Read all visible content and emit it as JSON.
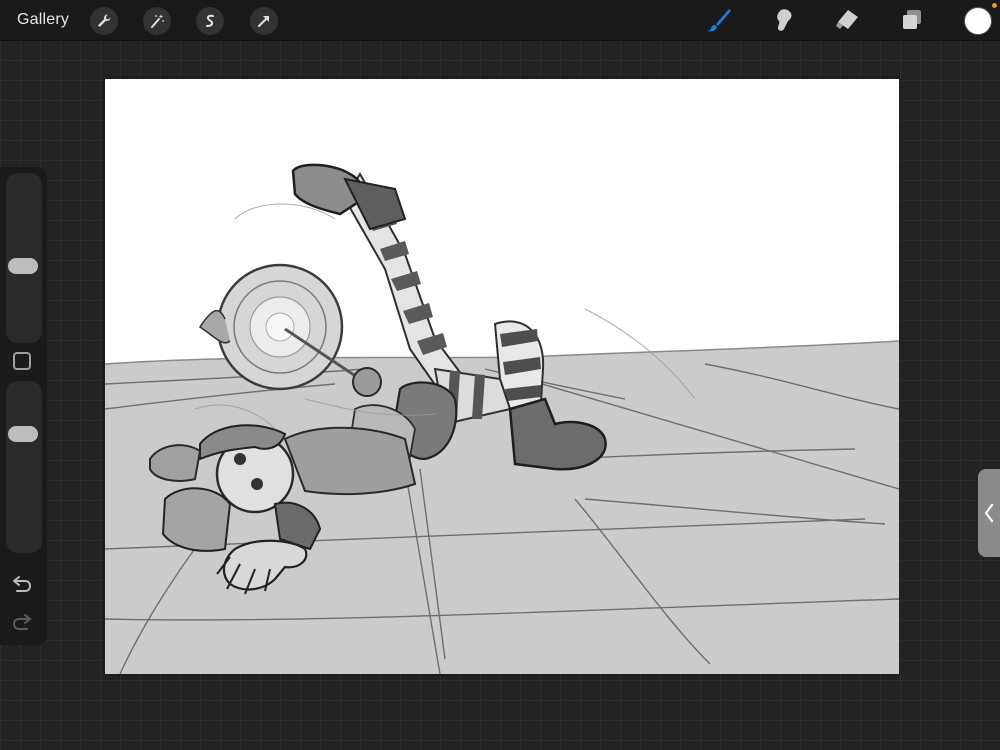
{
  "topbar": {
    "gallery_label": "Gallery",
    "left_tools": [
      {
        "icon": "wrench-icon",
        "name": "actions-button"
      },
      {
        "icon": "magic-wand-icon",
        "name": "adjustments-button"
      },
      {
        "icon": "selection-s-icon",
        "name": "selection-button"
      },
      {
        "icon": "transform-arrow-icon",
        "name": "transform-button"
      }
    ],
    "right_tools": [
      {
        "icon": "brush-icon",
        "name": "paint-tool",
        "active": true
      },
      {
        "icon": "smudge-icon",
        "name": "smudge-tool",
        "active": false
      },
      {
        "icon": "eraser-icon",
        "name": "eraser-tool",
        "active": false
      },
      {
        "icon": "layers-icon",
        "name": "layers-button",
        "active": false
      }
    ],
    "current_color": "#ffffff",
    "notification_color": "#e8962b"
  },
  "sidebar": {
    "brush_size_level": 0.55,
    "brush_opacity_level": 0.72,
    "modify_icon": "square-icon",
    "undo_icon": "undo-icon",
    "redo_icon": "redo-icon"
  },
  "right_panel": {
    "handle_icon": "chevron-left-icon"
  },
  "colors": {
    "accent": "#1f7ae0",
    "toolbar_bg": "#1a1a1a",
    "canvas_bg": "#ffffff",
    "ground_gray": "#c8c8c8"
  },
  "canvas": {
    "content": "pencil-sketch-illustration"
  }
}
